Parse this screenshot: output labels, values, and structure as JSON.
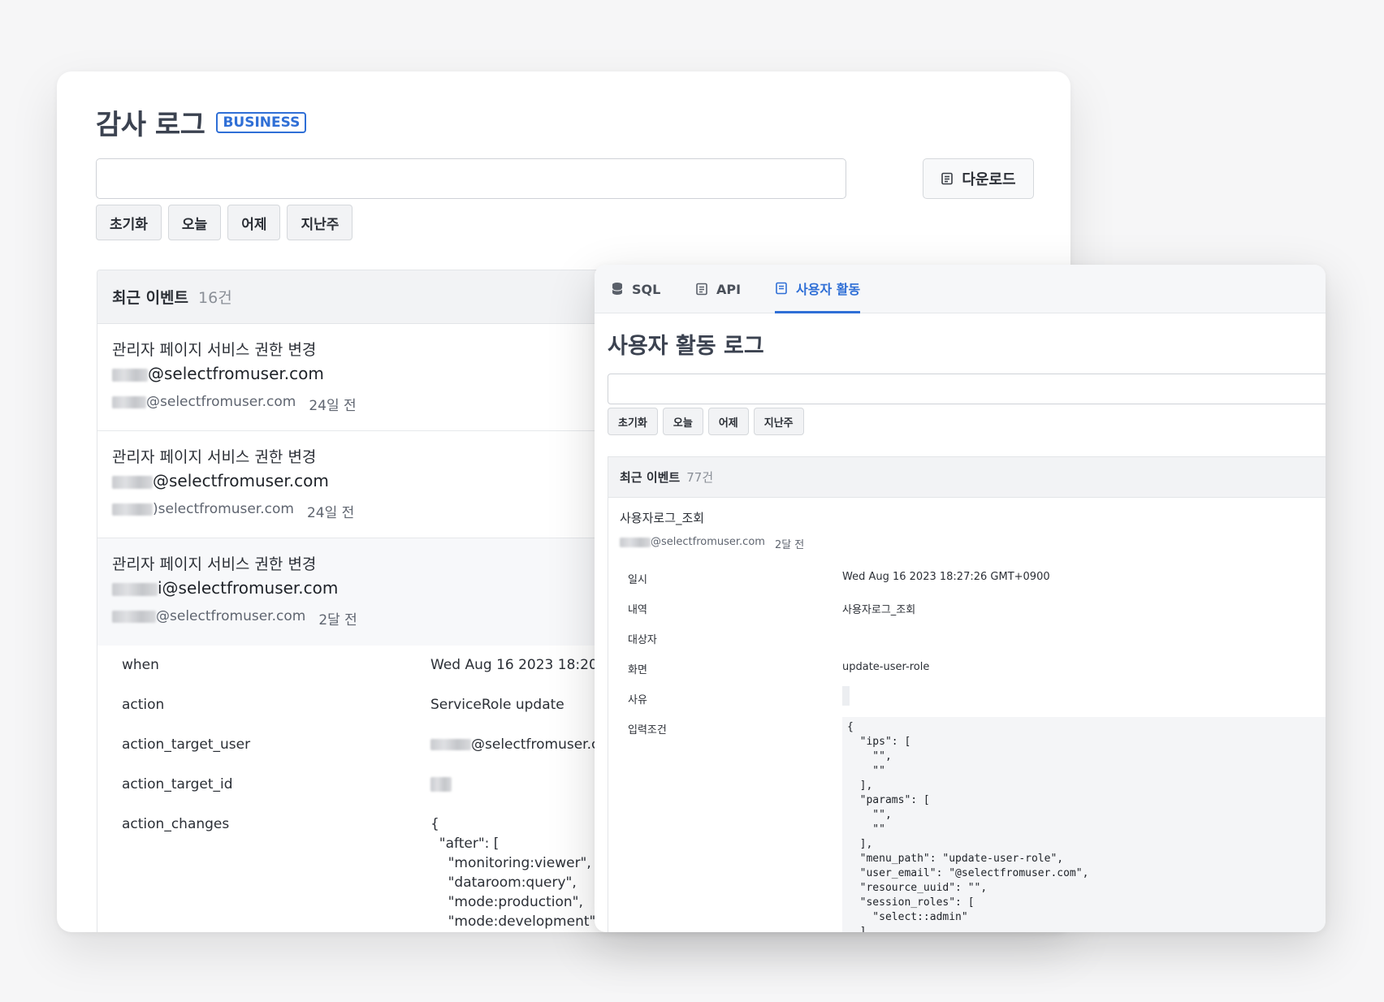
{
  "audit": {
    "title": "감사 로그",
    "badge": "BUSINESS",
    "download_label": "다운로드",
    "chips": [
      "초기화",
      "오늘",
      "어제",
      "지난주"
    ],
    "panel_title": "최근 이벤트",
    "panel_count": "16건",
    "events": [
      {
        "title": "관리자 페이지 서비스 권한 변경",
        "email": "@selectfromuser.com",
        "actor": "@selectfromuser.com",
        "time": "24일 전"
      },
      {
        "title": "관리자 페이지 서비스 권한 변경",
        "email": "@selectfromuser.com",
        "actor": ")selectfromuser.com",
        "time": "24일 전"
      },
      {
        "title": "관리자 페이지 서비스 권한 변경",
        "email": "i@selectfromuser.com",
        "actor": "@selectfromuser.com",
        "time": "2달 전"
      }
    ],
    "detail": {
      "rows": [
        {
          "key": "when",
          "value": "Wed Aug 16 2023 18:20"
        },
        {
          "key": "action",
          "value": "ServiceRole update"
        },
        {
          "key": "action_target_user",
          "value": "@selectfromuser.c"
        },
        {
          "key": "action_target_id",
          "value": ""
        },
        {
          "key": "action_changes",
          "value": "{\n  \"after\": [\n    \"monitoring:viewer\",\n    \"dataroom:query\",\n    \"mode:production\",\n    \"mode:development\""
        }
      ]
    }
  },
  "activity": {
    "tabs": [
      {
        "label": "SQL",
        "icon": "database-icon"
      },
      {
        "label": "API",
        "icon": "document-icon"
      },
      {
        "label": "사용자 활동",
        "icon": "activity-icon"
      }
    ],
    "title": "사용자 활동 로그",
    "chips": [
      "초기화",
      "오늘",
      "어제",
      "지난주"
    ],
    "panel_title": "최근 이벤트",
    "panel_count": "77건",
    "event": {
      "title": "사용자로그_조회",
      "actor": "@selectfromuser.com",
      "time": "2달 전"
    },
    "fields": [
      {
        "label": "일시",
        "value": "Wed Aug 16 2023 18:27:26 GMT+0900"
      },
      {
        "label": "내역",
        "value": "사용자로그_조회"
      },
      {
        "label": "대상자",
        "value": ""
      },
      {
        "label": "화면",
        "value": "update-user-role"
      },
      {
        "label": "사유",
        "value": ""
      },
      {
        "label": "입력조건",
        "value": ""
      }
    ],
    "code": "{\n  \"ips\": [\n    \"\",\n    \"\"\n  ],\n  \"params\": [\n    \"\",\n    \"\"\n  ],\n  \"menu_path\": \"update-user-role\",\n  \"user_email\": \"@selectfromuser.com\",\n  \"resource_uuid\": \"\",\n  \"session_roles\": [\n    \"select::admin\"\n  ]\n}"
  },
  "colors": {
    "accent": "#2f6fd6",
    "title": "#3b4250",
    "muted": "#8a8f97"
  }
}
